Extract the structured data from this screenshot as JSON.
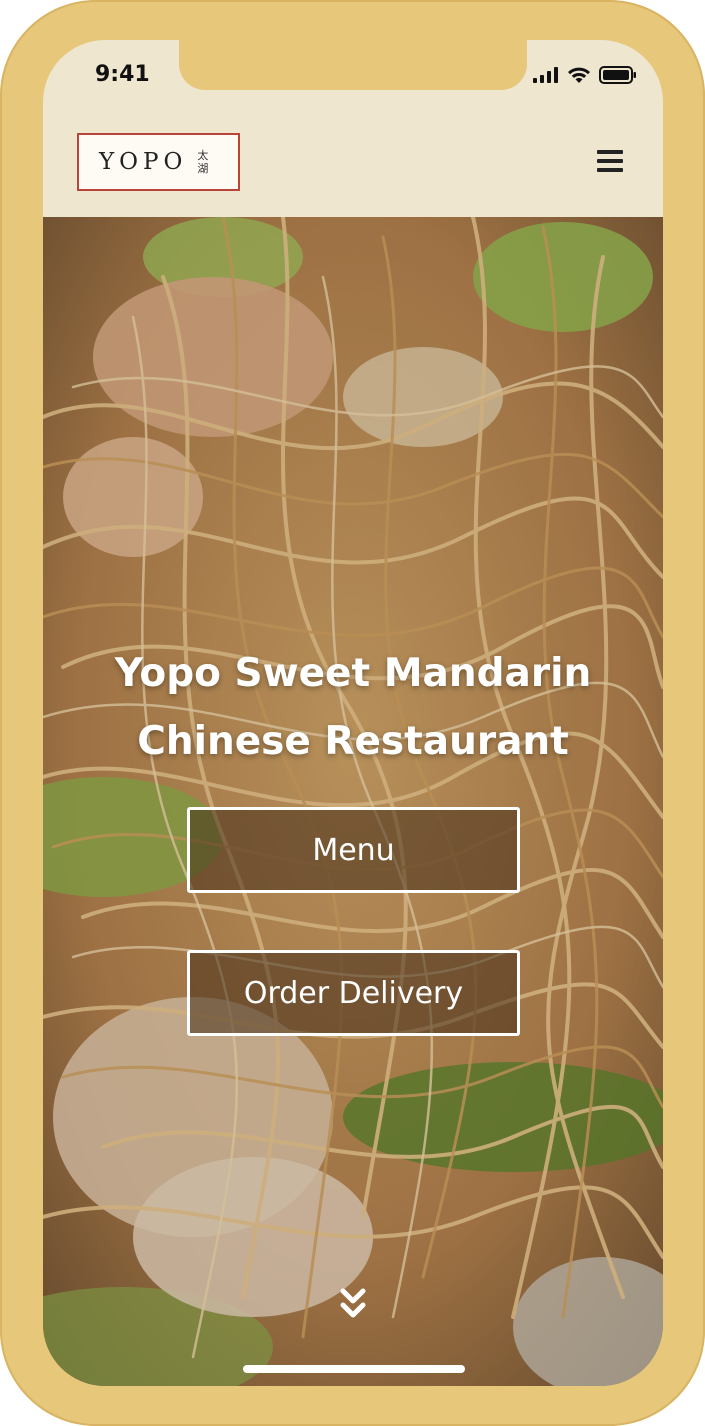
{
  "status_bar": {
    "time": "9:41",
    "icons": [
      "cellular-signal-icon",
      "wifi-icon",
      "battery-icon"
    ]
  },
  "header": {
    "logo_text": "YOPO",
    "logo_chinese": "太湖",
    "menu_icon": "hamburger-menu-icon"
  },
  "hero": {
    "title": "Yopo Sweet Mandarin Chinese Restaurant",
    "buttons": {
      "menu_label": "Menu",
      "delivery_label": "Order Delivery"
    },
    "scroll_icon": "double-chevron-down-icon"
  },
  "colors": {
    "frame": "#e7c77a",
    "header_bg": "#eee6cf",
    "logo_border": "#b8443a",
    "button_border": "#ffffff",
    "title_text": "#ffffff"
  }
}
